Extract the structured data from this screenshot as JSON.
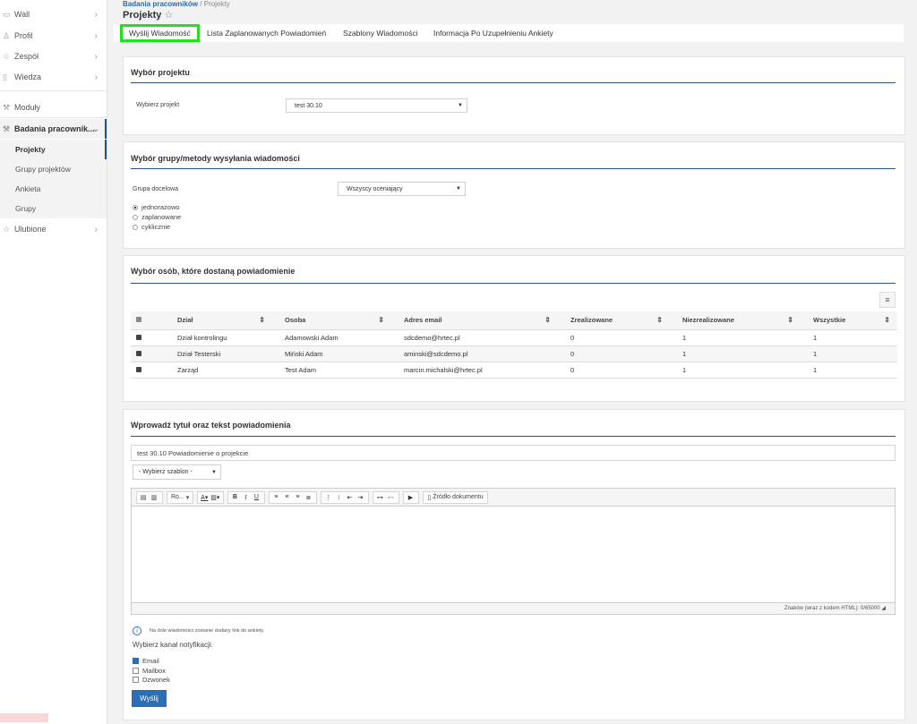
{
  "sidebar": {
    "items": [
      {
        "label": "Wall",
        "icon": "comment-icon"
      },
      {
        "label": "Profil",
        "icon": "user-icon"
      },
      {
        "label": "Zespół",
        "icon": "team-icon"
      },
      {
        "label": "Wiedza",
        "icon": "book-icon"
      },
      {
        "label": "Moduły",
        "icon": "wrench-icon"
      },
      {
        "label": "Badania pracownik...",
        "icon": "wrench-icon"
      },
      {
        "label": "Ulubione",
        "icon": "star-icon"
      }
    ],
    "sub": [
      "Projekty",
      "Grupy projektów",
      "Ankieta",
      "Grupy"
    ]
  },
  "breadcrumb": {
    "parent": "Badania pracowników",
    "sep": "/",
    "current": "Projekty"
  },
  "page_title": "Projekty",
  "tabs": [
    "Wyślij Wiadomość",
    "Lista Zaplanowanych Powiadomień",
    "Szablony Wiadomości",
    "Informacja Po Uzupełnieniu Ankiety"
  ],
  "project": {
    "heading": "Wybór projektu",
    "label": "Wybierz projekt",
    "value": "test 30.10"
  },
  "group": {
    "heading": "Wybór grupy/metody wysyłania wiadomości",
    "label": "Grupa docelowa",
    "value": "Wszyscy oceniający",
    "radios": [
      "jednorazowo",
      "zaplanowane",
      "cyklicznie"
    ],
    "selected": "jednorazowo"
  },
  "people": {
    "heading": "Wybór osób, które dostaną powiadomienie",
    "columns": [
      "Dział",
      "Osoba",
      "Adres email",
      "Zrealizowane",
      "Niezrealizowane",
      "Wszystkie"
    ],
    "rows": [
      [
        "Dział kontrolingu",
        "Adamowski Adam",
        "sdcdemo@hrtec.pl",
        "0",
        "1",
        "1"
      ],
      [
        "Dział Testerski",
        "Miński Adam",
        "aminski@sdcdemo.pl",
        "0",
        "1",
        "1"
      ],
      [
        "Zarząd",
        "Test Adam",
        "marcin.michalski@hrtec.pl",
        "0",
        "1",
        "1"
      ]
    ]
  },
  "message": {
    "heading": "Wprowadź tytuł oraz tekst powiadomienia",
    "title_value": "test 30.10 Powiadomienie o projekcie",
    "template": "- Wybierz szablon -",
    "font_label": "Ro...",
    "source_label": "Źródło dokumentu",
    "char_count": "Znaków (wraz z kodem HTML): 0/65000",
    "info": "Na dole wiadomości zostanie dodany link do ankiety.",
    "channel_label": "Wybierz kanał notyfikacji:",
    "channels": [
      "Email",
      "Mailbox",
      "Dzwonek"
    ],
    "send_label": "Wyślij"
  },
  "colors": {
    "accent": "#2a6eb6",
    "highlight": "#22e022",
    "heading_line": "#2a4f78"
  }
}
